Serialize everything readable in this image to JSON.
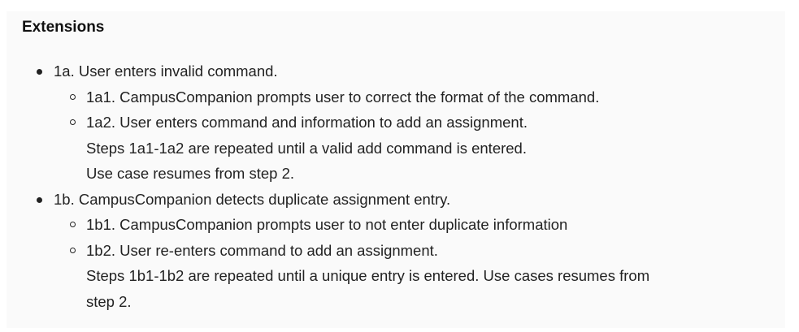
{
  "section": {
    "heading": "Extensions"
  },
  "extensions": [
    {
      "text": "1a. User enters invalid command.",
      "steps": [
        {
          "lines": [
            "1a1. CampusCompanion prompts user to correct the format of the command."
          ]
        },
        {
          "lines": [
            "1a2. User enters command and information to add an assignment.",
            "Steps 1a1-1a2 are repeated until a valid add command is entered.",
            "Use case resumes from step 2."
          ]
        }
      ]
    },
    {
      "text": "1b. CampusCompanion detects duplicate assignment entry.",
      "steps": [
        {
          "lines": [
            "1b1. CampusCompanion prompts user to not enter duplicate information"
          ]
        },
        {
          "lines": [
            "1b2. User re-enters command to add an assignment.",
            "Steps 1b1-1b2 are repeated until a unique entry is entered. Use cases resumes from",
            "step 2."
          ]
        }
      ]
    }
  ]
}
